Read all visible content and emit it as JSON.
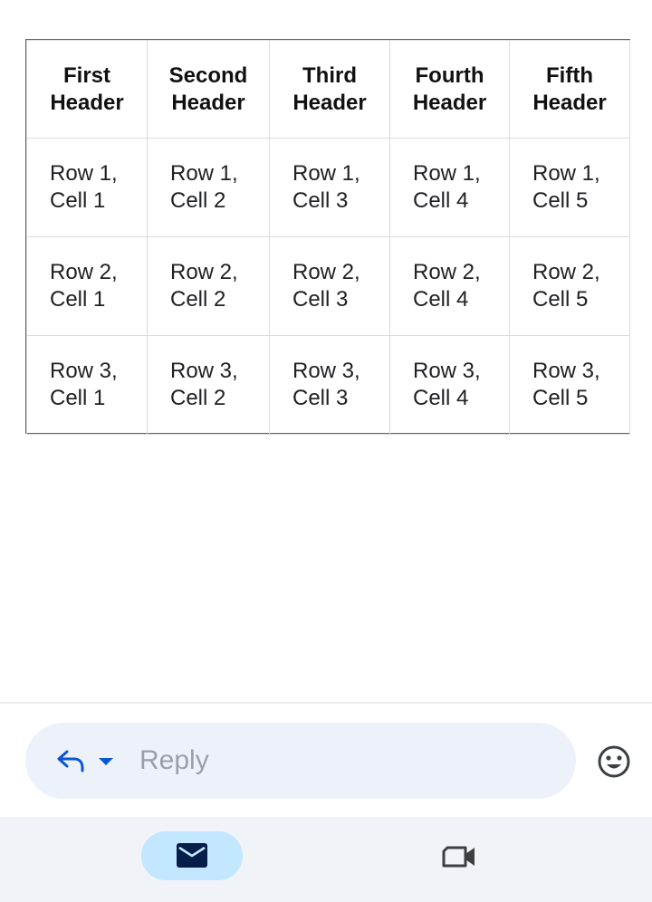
{
  "table": {
    "headers": [
      {
        "line1": "First",
        "line2": "Header"
      },
      {
        "line1": "Second",
        "line2": "Header"
      },
      {
        "line1": "Third",
        "line2": "Header"
      },
      {
        "line1": "Fourth",
        "line2": "Header"
      },
      {
        "line1": "Fifth",
        "line2": "Header"
      }
    ],
    "rows": [
      [
        {
          "line1": "Row 1,",
          "line2": "Cell 1"
        },
        {
          "line1": "Row 1,",
          "line2": "Cell 2"
        },
        {
          "line1": "Row 1,",
          "line2": "Cell 3"
        },
        {
          "line1": "Row 1,",
          "line2": "Cell 4"
        },
        {
          "line1": "Row 1,",
          "line2": "Cell 5"
        }
      ],
      [
        {
          "line1": "Row 2,",
          "line2": "Cell 1"
        },
        {
          "line1": "Row 2,",
          "line2": "Cell 2"
        },
        {
          "line1": "Row 2,",
          "line2": "Cell 3"
        },
        {
          "line1": "Row 2,",
          "line2": "Cell 4"
        },
        {
          "line1": "Row 2,",
          "line2": "Cell 5"
        }
      ],
      [
        {
          "line1": "Row 3,",
          "line2": "Cell 1"
        },
        {
          "line1": "Row 3,",
          "line2": "Cell 2"
        },
        {
          "line1": "Row 3,",
          "line2": "Cell 3"
        },
        {
          "line1": "Row 3,",
          "line2": "Cell 4"
        },
        {
          "line1": "Row 3,",
          "line2": "Cell 5"
        }
      ]
    ]
  },
  "reply_bar": {
    "placeholder": "Reply",
    "reply_icon": "reply-arrow-icon",
    "dropdown_icon": "caret-down-icon"
  },
  "emoji_icon": "smiley-icon",
  "bottom_nav": {
    "items": [
      {
        "icon": "mail-icon",
        "active": true
      },
      {
        "icon": "video-camera-icon",
        "active": false
      }
    ]
  },
  "colors": {
    "accent": "#0b57d0",
    "reply_bar_bg": "#edf2fa",
    "nav_bg": "#f0f3f8",
    "nav_active_pill": "#c2e7ff"
  }
}
